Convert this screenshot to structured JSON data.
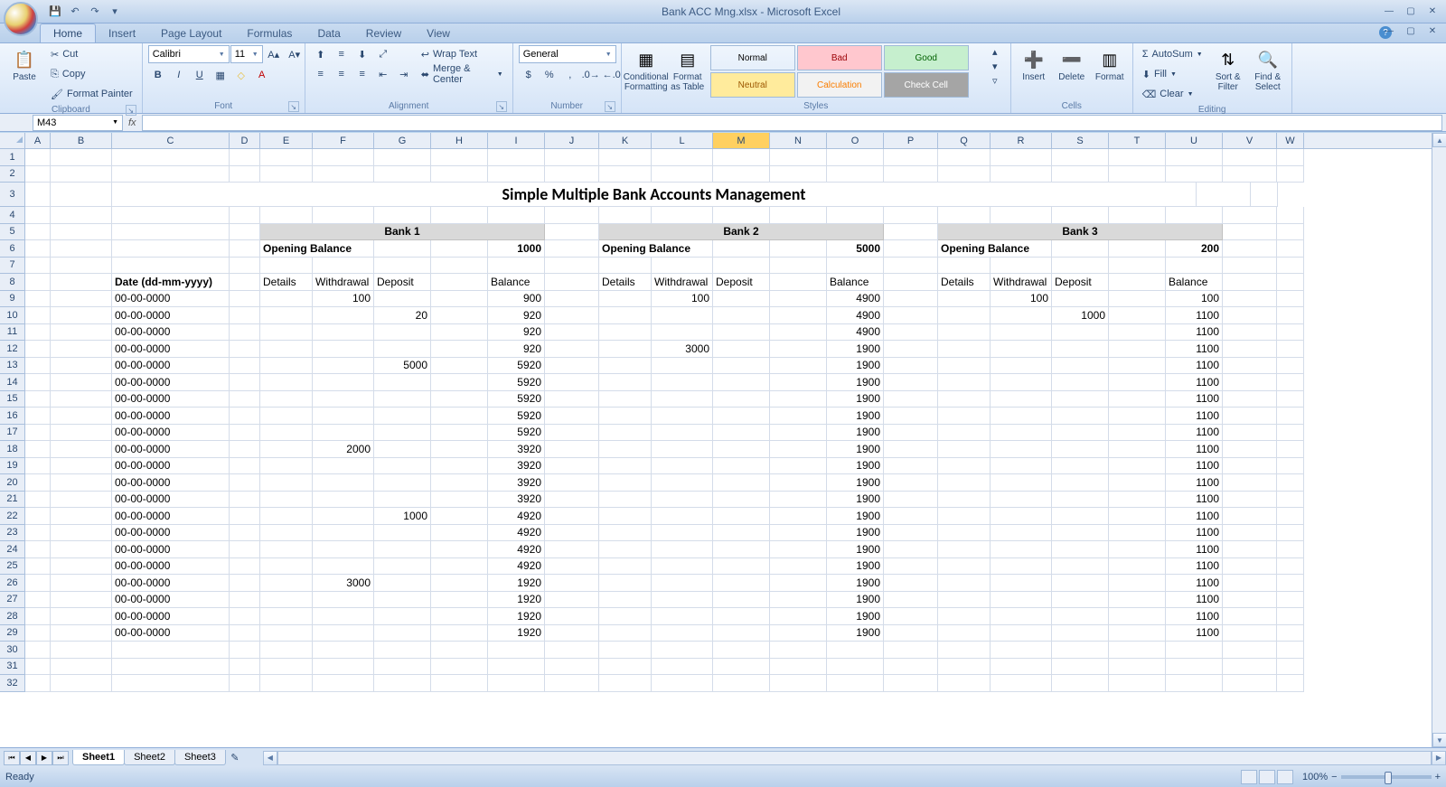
{
  "app": {
    "title": "Bank ACC Mng.xlsx - Microsoft Excel"
  },
  "qat": {
    "save": "💾",
    "undo": "↶",
    "redo": "↷"
  },
  "tabs": {
    "home": "Home",
    "insert": "Insert",
    "pagelayout": "Page Layout",
    "formulas": "Formulas",
    "data": "Data",
    "review": "Review",
    "view": "View"
  },
  "ribbon": {
    "clipboard": {
      "label": "Clipboard",
      "paste": "Paste",
      "cut": "Cut",
      "copy": "Copy",
      "formatpainter": "Format Painter"
    },
    "font": {
      "label": "Font",
      "fontname": "Calibri",
      "fontsize": "11"
    },
    "alignment": {
      "label": "Alignment",
      "wrap": "Wrap Text",
      "merge": "Merge & Center"
    },
    "number": {
      "label": "Number",
      "format": "General"
    },
    "styles": {
      "label": "Styles",
      "condfmt": "Conditional Formatting",
      "fmttable": "Format as Table",
      "normal": "Normal",
      "bad": "Bad",
      "good": "Good",
      "neutral": "Neutral",
      "calc": "Calculation",
      "check": "Check Cell"
    },
    "cells": {
      "label": "Cells",
      "insert": "Insert",
      "delete": "Delete",
      "format": "Format"
    },
    "editing": {
      "label": "Editing",
      "autosum": "AutoSum",
      "fill": "Fill",
      "clear": "Clear",
      "sort": "Sort & Filter",
      "find": "Find & Select"
    }
  },
  "namebox": "M43",
  "columns": [
    "A",
    "B",
    "C",
    "D",
    "E",
    "F",
    "G",
    "H",
    "I",
    "J",
    "K",
    "L",
    "M",
    "N",
    "O",
    "P",
    "Q",
    "R",
    "S",
    "T",
    "U",
    "V",
    "W"
  ],
  "selectedCol": "M",
  "sheet": {
    "title": "Simple Multiple Bank Accounts Management",
    "banks": [
      "Bank 1",
      "Bank 2",
      "Bank 3"
    ],
    "opening_label": "Opening Balance",
    "openings": [
      "1000",
      "5000",
      "200"
    ],
    "date_hdr": "Date (dd-mm-yyyy)",
    "cols": [
      "Details",
      "Withdrawal",
      "Deposit",
      "",
      "Balance"
    ],
    "rows": [
      {
        "d": "00-00-0000",
        "b1": [
          "",
          "100",
          "",
          "",
          "900"
        ],
        "b2": [
          "",
          "100",
          "",
          "",
          "4900"
        ],
        "b3": [
          "",
          "100",
          "",
          "",
          "100"
        ]
      },
      {
        "d": "00-00-0000",
        "b1": [
          "",
          "",
          "20",
          "",
          "920"
        ],
        "b2": [
          "",
          "",
          "",
          "",
          "4900"
        ],
        "b3": [
          "",
          "",
          "1000",
          "",
          "1100"
        ]
      },
      {
        "d": "00-00-0000",
        "b1": [
          "",
          "",
          "",
          "",
          "920"
        ],
        "b2": [
          "",
          "",
          "",
          "",
          "4900"
        ],
        "b3": [
          "",
          "",
          "",
          "",
          "1100"
        ]
      },
      {
        "d": "00-00-0000",
        "b1": [
          "",
          "",
          "",
          "",
          "920"
        ],
        "b2": [
          "",
          "3000",
          "",
          "",
          "1900"
        ],
        "b3": [
          "",
          "",
          "",
          "",
          "1100"
        ]
      },
      {
        "d": "00-00-0000",
        "b1": [
          "",
          "",
          "5000",
          "",
          "5920"
        ],
        "b2": [
          "",
          "",
          "",
          "",
          "1900"
        ],
        "b3": [
          "",
          "",
          "",
          "",
          "1100"
        ]
      },
      {
        "d": "00-00-0000",
        "b1": [
          "",
          "",
          "",
          "",
          "5920"
        ],
        "b2": [
          "",
          "",
          "",
          "",
          "1900"
        ],
        "b3": [
          "",
          "",
          "",
          "",
          "1100"
        ]
      },
      {
        "d": "00-00-0000",
        "b1": [
          "",
          "",
          "",
          "",
          "5920"
        ],
        "b2": [
          "",
          "",
          "",
          "",
          "1900"
        ],
        "b3": [
          "",
          "",
          "",
          "",
          "1100"
        ]
      },
      {
        "d": "00-00-0000",
        "b1": [
          "",
          "",
          "",
          "",
          "5920"
        ],
        "b2": [
          "",
          "",
          "",
          "",
          "1900"
        ],
        "b3": [
          "",
          "",
          "",
          "",
          "1100"
        ]
      },
      {
        "d": "00-00-0000",
        "b1": [
          "",
          "",
          "",
          "",
          "5920"
        ],
        "b2": [
          "",
          "",
          "",
          "",
          "1900"
        ],
        "b3": [
          "",
          "",
          "",
          "",
          "1100"
        ]
      },
      {
        "d": "00-00-0000",
        "b1": [
          "",
          "2000",
          "",
          "",
          "3920"
        ],
        "b2": [
          "",
          "",
          "",
          "",
          "1900"
        ],
        "b3": [
          "",
          "",
          "",
          "",
          "1100"
        ]
      },
      {
        "d": "00-00-0000",
        "b1": [
          "",
          "",
          "",
          "",
          "3920"
        ],
        "b2": [
          "",
          "",
          "",
          "",
          "1900"
        ],
        "b3": [
          "",
          "",
          "",
          "",
          "1100"
        ]
      },
      {
        "d": "00-00-0000",
        "b1": [
          "",
          "",
          "",
          "",
          "3920"
        ],
        "b2": [
          "",
          "",
          "",
          "",
          "1900"
        ],
        "b3": [
          "",
          "",
          "",
          "",
          "1100"
        ]
      },
      {
        "d": "00-00-0000",
        "b1": [
          "",
          "",
          "",
          "",
          "3920"
        ],
        "b2": [
          "",
          "",
          "",
          "",
          "1900"
        ],
        "b3": [
          "",
          "",
          "",
          "",
          "1100"
        ]
      },
      {
        "d": "00-00-0000",
        "b1": [
          "",
          "",
          "1000",
          "",
          "4920"
        ],
        "b2": [
          "",
          "",
          "",
          "",
          "1900"
        ],
        "b3": [
          "",
          "",
          "",
          "",
          "1100"
        ]
      },
      {
        "d": "00-00-0000",
        "b1": [
          "",
          "",
          "",
          "",
          "4920"
        ],
        "b2": [
          "",
          "",
          "",
          "",
          "1900"
        ],
        "b3": [
          "",
          "",
          "",
          "",
          "1100"
        ]
      },
      {
        "d": "00-00-0000",
        "b1": [
          "",
          "",
          "",
          "",
          "4920"
        ],
        "b2": [
          "",
          "",
          "",
          "",
          "1900"
        ],
        "b3": [
          "",
          "",
          "",
          "",
          "1100"
        ]
      },
      {
        "d": "00-00-0000",
        "b1": [
          "",
          "",
          "",
          "",
          "4920"
        ],
        "b2": [
          "",
          "",
          "",
          "",
          "1900"
        ],
        "b3": [
          "",
          "",
          "",
          "",
          "1100"
        ]
      },
      {
        "d": "00-00-0000",
        "b1": [
          "",
          "3000",
          "",
          "",
          "1920"
        ],
        "b2": [
          "",
          "",
          "",
          "",
          "1900"
        ],
        "b3": [
          "",
          "",
          "",
          "",
          "1100"
        ]
      },
      {
        "d": "00-00-0000",
        "b1": [
          "",
          "",
          "",
          "",
          "1920"
        ],
        "b2": [
          "",
          "",
          "",
          "",
          "1900"
        ],
        "b3": [
          "",
          "",
          "",
          "",
          "1100"
        ]
      },
      {
        "d": "00-00-0000",
        "b1": [
          "",
          "",
          "",
          "",
          "1920"
        ],
        "b2": [
          "",
          "",
          "",
          "",
          "1900"
        ],
        "b3": [
          "",
          "",
          "",
          "",
          "1100"
        ]
      },
      {
        "d": "00-00-0000",
        "b1": [
          "",
          "",
          "",
          "",
          "1920"
        ],
        "b2": [
          "",
          "",
          "",
          "",
          "1900"
        ],
        "b3": [
          "",
          "",
          "",
          "",
          "1100"
        ]
      }
    ]
  },
  "sheets": [
    "Sheet1",
    "Sheet2",
    "Sheet3"
  ],
  "status": {
    "ready": "Ready",
    "zoom": "100%"
  }
}
